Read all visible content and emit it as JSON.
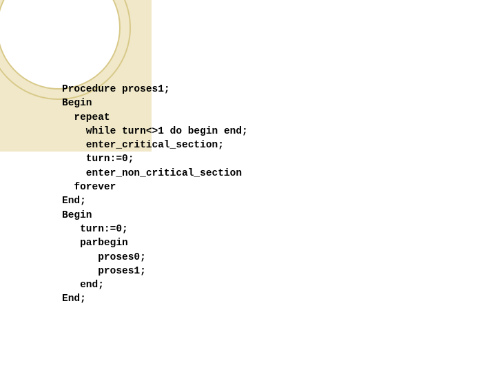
{
  "code": {
    "l1": "Procedure proses1;",
    "l2": "Begin",
    "l3": "  repeat",
    "l4": "    while turn<>1 do begin end;",
    "l5": "    enter_critical_section;",
    "l6": "    turn:=0;",
    "l7": "    enter_non_critical_section",
    "l8": "  forever",
    "l9": "End;",
    "l10": "Begin",
    "l11": "   turn:=0;",
    "l12": "   parbegin",
    "l13": "      proses0;",
    "l14": "      proses1;",
    "l15": "   end;",
    "l16": "End;"
  }
}
